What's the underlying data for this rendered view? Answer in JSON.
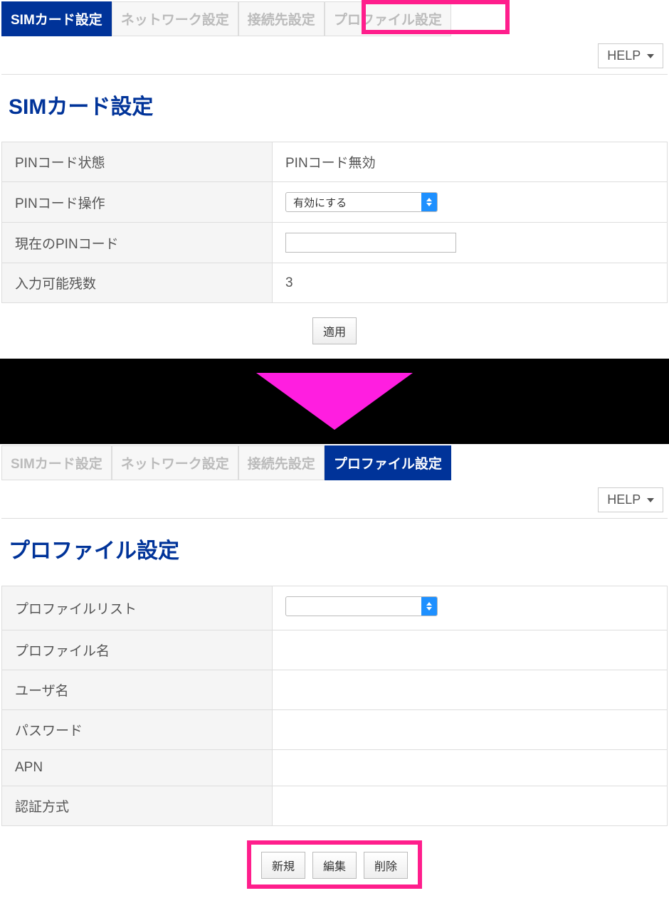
{
  "screen1": {
    "tabs": [
      "SIMカード設定",
      "ネットワーク設定",
      "接続先設定",
      "プロファイル設定"
    ],
    "help": "HELP",
    "title": "SIMカード設定",
    "rows": {
      "pin_status_label": "PINコード状態",
      "pin_status_value": "PINコード無効",
      "pin_op_label": "PINコード操作",
      "pin_op_select": "有効にする",
      "cur_pin_label": "現在のPINコード",
      "cur_pin_value": "",
      "remaining_label": "入力可能残数",
      "remaining_value": "3"
    },
    "apply": "適用"
  },
  "screen2": {
    "tabs": [
      "SIMカード設定",
      "ネットワーク設定",
      "接続先設定",
      "プロファイル設定"
    ],
    "help": "HELP",
    "title": "プロファイル設定",
    "rows": {
      "profile_list_label": "プロファイルリスト",
      "profile_list_value": "",
      "profile_name_label": "プロファイル名",
      "user_label": "ユーザ名",
      "password_label": "パスワード",
      "apn_label": "APN",
      "auth_label": "認証方式"
    },
    "buttons": {
      "new": "新規",
      "edit": "編集",
      "delete": "削除"
    }
  }
}
